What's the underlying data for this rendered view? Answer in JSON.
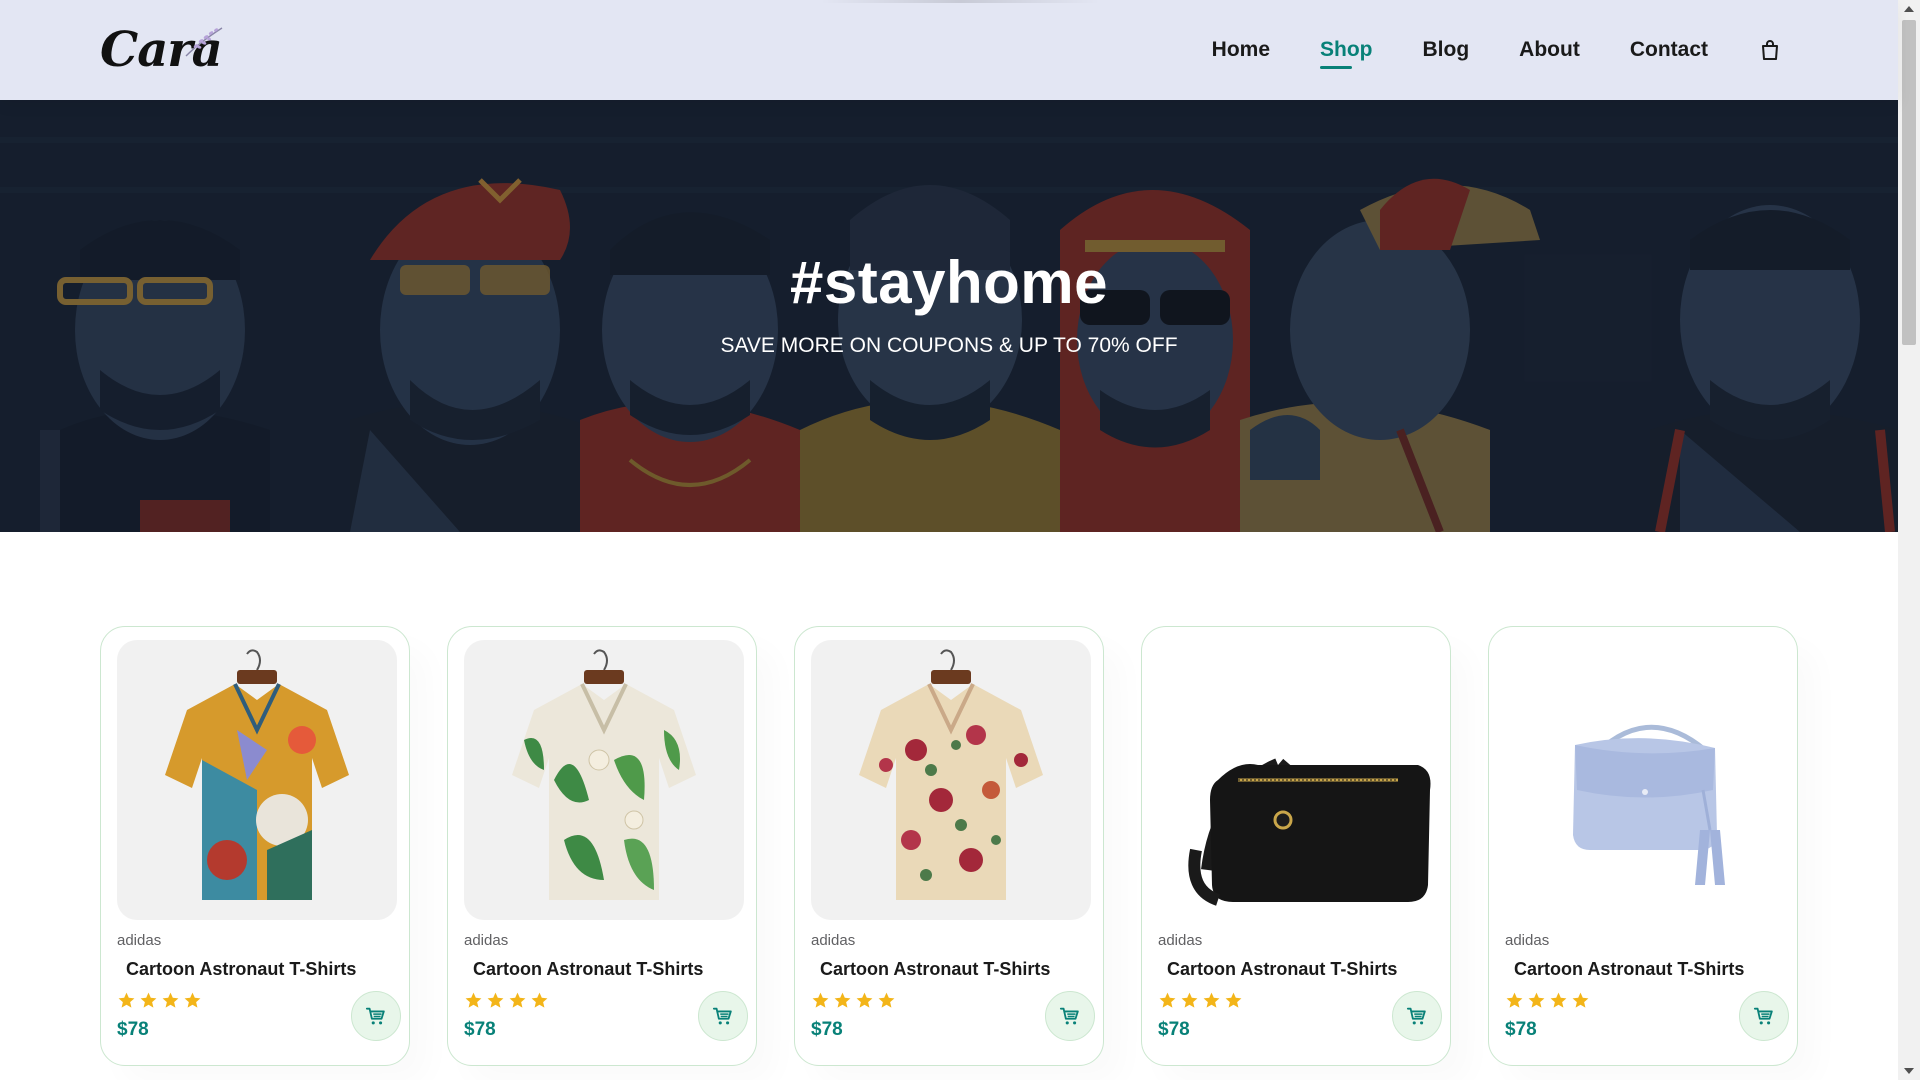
{
  "brand": {
    "logo_text": "Cara"
  },
  "nav": {
    "items": [
      {
        "label": "Home",
        "active": false
      },
      {
        "label": "Shop",
        "active": true
      },
      {
        "label": "Blog",
        "active": false
      },
      {
        "label": "About",
        "active": false
      },
      {
        "label": "Contact",
        "active": false
      }
    ],
    "cart_icon": "shopping-bag-icon"
  },
  "hero": {
    "title": "#stayhome",
    "subtitle": "SAVE MORE ON COUPONS & UP TO 70% OFF"
  },
  "products": [
    {
      "brand": "adidas",
      "name": "Cartoon Astronaut T-Shirts",
      "rating": 4,
      "price": "$78",
      "image": "colorful-abstract-shirt"
    },
    {
      "brand": "adidas",
      "name": "Cartoon Astronaut T-Shirts",
      "rating": 4,
      "price": "$78",
      "image": "green-leaf-floral-shirt"
    },
    {
      "brand": "adidas",
      "name": "Cartoon Astronaut T-Shirts",
      "rating": 4,
      "price": "$78",
      "image": "red-rose-floral-shirt"
    },
    {
      "brand": "adidas",
      "name": "Cartoon Astronaut T-Shirts",
      "rating": 4,
      "price": "$78",
      "image": "black-crossbody-bag"
    },
    {
      "brand": "adidas",
      "name": "Cartoon Astronaut T-Shirts",
      "rating": 4,
      "price": "$78",
      "image": "light-blue-tassel-bag"
    }
  ],
  "colors": {
    "accent": "#088178",
    "header_bg": "#e3e6f3",
    "star": "#f3b519",
    "cart_bg": "#e8f6ea",
    "card_border": "#cce7d0"
  }
}
